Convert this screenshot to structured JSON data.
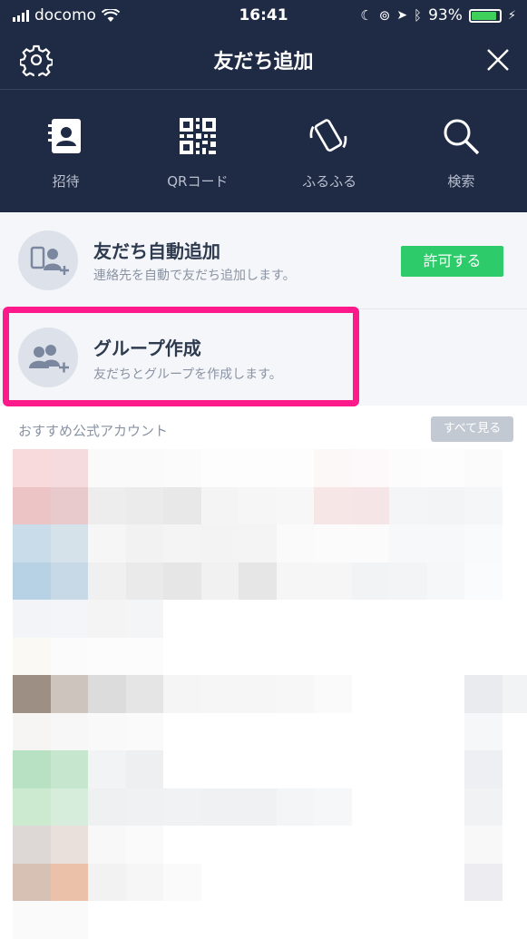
{
  "status": {
    "carrier": "docomo",
    "time": "16:41",
    "battery": "93%"
  },
  "header": {
    "title": "友だち追加"
  },
  "tools": [
    {
      "name": "invite",
      "label": "招待"
    },
    {
      "name": "qr",
      "label": "QRコード"
    },
    {
      "name": "shake",
      "label": "ふるふる"
    },
    {
      "name": "search",
      "label": "検索"
    }
  ],
  "auto_add": {
    "title": "友だち自動追加",
    "subtitle": "連絡先を自動で友だち追加します。",
    "button": "許可する"
  },
  "group": {
    "title": "グループ作成",
    "subtitle": "友だちとグループを作成します。"
  },
  "recommended": {
    "heading": "おすすめ公式アカウント",
    "see_all": "すべて見る"
  },
  "colors": {
    "header_bg": "#1f2a44",
    "accent_green": "#2dcb6a",
    "highlight": "#ff1a8c"
  },
  "mosaic_rows": [
    [
      "#f8d9dc",
      "#f6dbde",
      "#fafafa",
      "#fafafa",
      "#fbfbfb",
      "#fdfdfd",
      "#fdfdfd",
      "#fdfdfd",
      "#fdf8f8",
      "#fdf9fa",
      "#fcfcfc",
      "#fdfdfd",
      "#fbfbfb",
      "#ffffff"
    ],
    [
      "#ecc4c6",
      "#e8c9cc",
      "#ededed",
      "#ebebeb",
      "#e8e8e8",
      "#f4f4f4",
      "#f6f6f6",
      "#f7f7f7",
      "#f7e6e6",
      "#f6e5e6",
      "#f4f5f7",
      "#f3f4f6",
      "#f5f6f8",
      "#ffffff"
    ],
    [
      "#c8dcea",
      "#d5e2ea",
      "#f6f6f6",
      "#f2f2f2",
      "#f4f4f4",
      "#f3f3f3",
      "#f4f4f4",
      "#fafafa",
      "#fbfbfb",
      "#fbfbfb",
      "#f7f8fa",
      "#f7f8fa",
      "#f9fafb",
      "#ffffff"
    ],
    [
      "#b8d2e5",
      "#c7d9e6",
      "#f0f0f0",
      "#eaeaea",
      "#e6e6e6",
      "#f1f1f1",
      "#e6e6e6",
      "#f6f6f6",
      "#f6f6f6",
      "#f2f3f5",
      "#f3f4f6",
      "#f6f7f9",
      "#fafbfc",
      "#ffffff"
    ],
    [
      "#f2f4f7",
      "#f4f5f8",
      "#f4f4f5",
      "#f4f5f6",
      "#ffffff",
      "#ffffff",
      "#ffffff",
      "#ffffff",
      "#ffffff",
      "#ffffff",
      "#ffffff",
      "#ffffff",
      "#ffffff",
      "#ffffff"
    ],
    [
      "#fbf9f4",
      "#fbfbfb",
      "#fcfcfc",
      "#fcfcfc",
      "#ffffff",
      "#ffffff",
      "#ffffff",
      "#ffffff",
      "#ffffff",
      "#ffffff",
      "#ffffff",
      "#ffffff",
      "#ffffff",
      "#ffffff"
    ],
    [
      "#9d8f84",
      "#cdc4bd",
      "#dcdcdc",
      "#e5e5e5",
      "#f5f5f5",
      "#f6f6f6",
      "#f6f6f6",
      "#f7f7f7",
      "#fafafa",
      "#ffffff",
      "#ffffff",
      "#ffffff",
      "#eaebef",
      "#f2f3f5"
    ],
    [
      "#f6f5f4",
      "#f7f7f7",
      "#f9f9f9",
      "#fafafa",
      "#ffffff",
      "#ffffff",
      "#ffffff",
      "#ffffff",
      "#ffffff",
      "#ffffff",
      "#ffffff",
      "#ffffff",
      "#f6f7f8",
      "#ffffff"
    ],
    [
      "#b8e0c2",
      "#c6e6cd",
      "#f2f3f5",
      "#eeeff1",
      "#ffffff",
      "#ffffff",
      "#ffffff",
      "#ffffff",
      "#ffffff",
      "#ffffff",
      "#ffffff",
      "#ffffff",
      "#eeeff2",
      "#ffffff"
    ],
    [
      "#cbeacf",
      "#d7eddb",
      "#eff0f2",
      "#f0f1f3",
      "#f1f2f4",
      "#f0f1f3",
      "#f0f1f3",
      "#f4f5f7",
      "#f6f7f8",
      "#ffffff",
      "#ffffff",
      "#ffffff",
      "#f1f2f4",
      "#ffffff"
    ],
    [
      "#ddd8d6",
      "#e9e0db",
      "#f8f8f8",
      "#fafafa",
      "#ffffff",
      "#ffffff",
      "#ffffff",
      "#ffffff",
      "#ffffff",
      "#ffffff",
      "#ffffff",
      "#ffffff",
      "#f8f8f9",
      "#ffffff"
    ],
    [
      "#d7c0b4",
      "#ebc1aa",
      "#f2f2f2",
      "#f6f6f6",
      "#fafafa",
      "#ffffff",
      "#ffffff",
      "#ffffff",
      "#ffffff",
      "#ffffff",
      "#ffffff",
      "#ffffff",
      "#ededf1",
      "#ffffff"
    ],
    [
      "#fafafa",
      "#fafafa",
      "#ffffff",
      "#ffffff",
      "#ffffff",
      "#ffffff",
      "#ffffff",
      "#ffffff",
      "#ffffff",
      "#ffffff",
      "#ffffff",
      "#ffffff",
      "#ffffff",
      "#ffffff"
    ]
  ]
}
